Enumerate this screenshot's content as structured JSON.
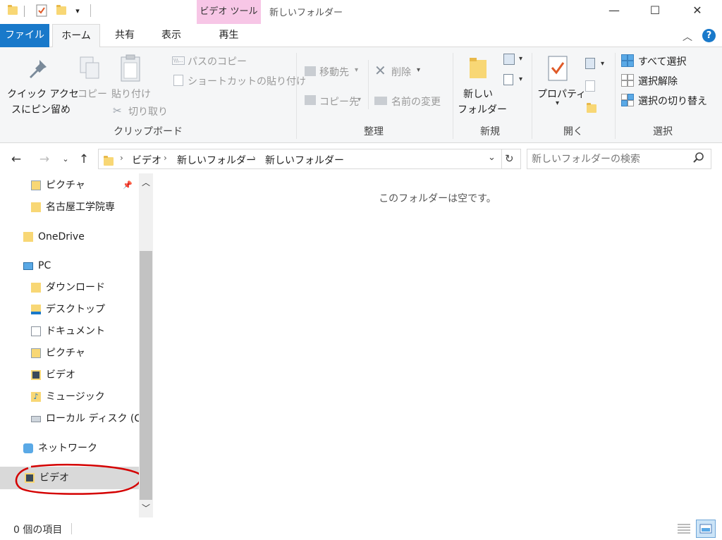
{
  "titlebar": {
    "context_tab_title": "ビデオ ツール",
    "window_title": "新しいフォルダー",
    "minimize": "—",
    "maximize": "☐",
    "close": "✕"
  },
  "tabs": {
    "file": "ファイル",
    "home": "ホーム",
    "share": "共有",
    "view": "表示",
    "playback": "再生"
  },
  "ribbon": {
    "clipboard": {
      "pin_line1": "クイック アクセ",
      "pin_line2": "スにピン留め",
      "copy": "コピー",
      "paste": "貼り付け",
      "copy_path": "パスのコピー",
      "paste_shortcut": "ショートカットの貼り付け",
      "cut": "切り取り",
      "group": "クリップボード"
    },
    "organize": {
      "move_to": "移動先",
      "copy_to": "コピー先",
      "delete": "削除",
      "rename": "名前の変更",
      "group": "整理"
    },
    "new": {
      "new_folder_line1": "新しい",
      "new_folder_line2": "フォルダー",
      "group": "新規"
    },
    "open": {
      "properties": "プロパティ",
      "group": "開く"
    },
    "select": {
      "select_all": "すべて選択",
      "select_none": "選択解除",
      "invert": "選択の切り替え",
      "group": "選択"
    }
  },
  "address": {
    "crumbs": [
      "ビデオ",
      "新しいフォルダー",
      "新しいフォルダー"
    ],
    "search_placeholder": "新しいフォルダーの検索"
  },
  "nav": {
    "pictures_quick": "ピクチャ",
    "nagoya": "名古屋工学院専",
    "onedrive": "OneDrive",
    "pc": "PC",
    "downloads": "ダウンロード",
    "desktop": "デスクトップ",
    "documents": "ドキュメント",
    "pictures": "ピクチャ",
    "videos": "ビデオ",
    "music": "ミュージック",
    "local_disk": "ローカル ディスク (C:)",
    "network": "ネットワーク",
    "video_lib": "ビデオ"
  },
  "content": {
    "empty_message": "このフォルダーは空です。"
  },
  "status": {
    "item_count": "0 個の項目"
  },
  "colors": {
    "accent": "#1979ca",
    "context_tab": "#f7c6e6",
    "annotation_circle": "#d40000",
    "folder": "#f8d775"
  }
}
